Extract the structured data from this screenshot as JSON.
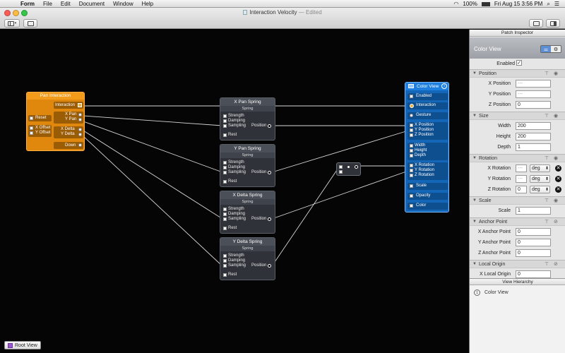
{
  "menubar": {
    "app": "Form",
    "items": [
      "File",
      "Edit",
      "Document",
      "Window",
      "Help"
    ],
    "battery": "100%",
    "clock": "Fri Aug 15  3:56 PM"
  },
  "window": {
    "title": "Interaction Velocity",
    "status": "— Edited"
  },
  "canvas": {
    "pan_interaction": {
      "title": "Pan Interaction",
      "interaction": "Interaction",
      "reset": "Reset",
      "x_pan": "X Pan",
      "y_pan": "Y Pan",
      "x_offset": "X Offset",
      "y_offset": "Y Offset",
      "x_delta": "X Delta",
      "y_delta": "Y Delta",
      "down": "Down"
    },
    "springs": [
      {
        "title": "X Pan Spring",
        "subtitle": "Spring",
        "strength": "Strength",
        "damping": "Damping",
        "sampling": "Sampling",
        "position": "Position",
        "rest": "Rest"
      },
      {
        "title": "Y Pan Spring",
        "subtitle": "Spring",
        "strength": "Strength",
        "damping": "Damping",
        "sampling": "Sampling",
        "position": "Position",
        "rest": "Rest"
      },
      {
        "title": "X Delta Spring",
        "subtitle": "Spring",
        "strength": "Strength",
        "damping": "Damping",
        "sampling": "Sampling",
        "position": "Position",
        "rest": "Rest"
      },
      {
        "title": "Y Delta Spring",
        "subtitle": "Spring",
        "strength": "Strength",
        "damping": "Damping",
        "sampling": "Sampling",
        "position": "Position",
        "rest": "Rest"
      }
    ],
    "color_view": {
      "title": "Color View",
      "enabled": "Enabled",
      "interaction": "Interaction",
      "gesture": "Gesture",
      "x_position": "X Position",
      "y_position": "Y Position",
      "z_position": "Z Position",
      "width": "Width",
      "height": "Height",
      "depth": "Depth",
      "x_rotation": "X Rotation",
      "y_rotation": "Y Rotation",
      "z_rotation": "Z Rotation",
      "scale": "Scale",
      "opacity": "Opacity",
      "color": "Color"
    },
    "root_view": "Root View"
  },
  "inspector": {
    "header": "Patch Inspector",
    "title": "Color View",
    "enabled_label": "Enabled",
    "sections": {
      "position": "Position",
      "size": "Size",
      "rotation": "Rotation",
      "scale": "Scale",
      "anchor_point": "Anchor Point",
      "local_origin": "Local Origin"
    },
    "fields": {
      "x_position": {
        "label": "X Position",
        "value": "---"
      },
      "y_position": {
        "label": "Y Position",
        "value": "---"
      },
      "z_position": {
        "label": "Z Position",
        "value": "0"
      },
      "width": {
        "label": "Width",
        "value": "200"
      },
      "height": {
        "label": "Height",
        "value": "200"
      },
      "depth": {
        "label": "Depth",
        "value": "1"
      },
      "x_rotation": {
        "label": "X Rotation",
        "value": "---",
        "unit": "deg"
      },
      "y_rotation": {
        "label": "Y Rotation",
        "value": "---",
        "unit": "deg"
      },
      "z_rotation": {
        "label": "Z Rotation",
        "value": "0",
        "unit": "deg"
      },
      "scale": {
        "label": "Scale",
        "value": "1"
      },
      "x_anchor": {
        "label": "X Anchor Point",
        "value": "0"
      },
      "y_anchor": {
        "label": "Y Anchor Point",
        "value": "0"
      },
      "z_anchor": {
        "label": "Z Anchor Point",
        "value": "0"
      },
      "x_local_origin": {
        "label": "X Local Origin",
        "value": "0"
      }
    },
    "view_hierarchy": {
      "header": "View Hierarchy",
      "items": [
        "Color View"
      ]
    }
  },
  "colors": {
    "canvas": "#050505",
    "interaction_patch": "#e0870e",
    "layer_patch": "#1466b8",
    "wire": "#d8d8d8"
  }
}
